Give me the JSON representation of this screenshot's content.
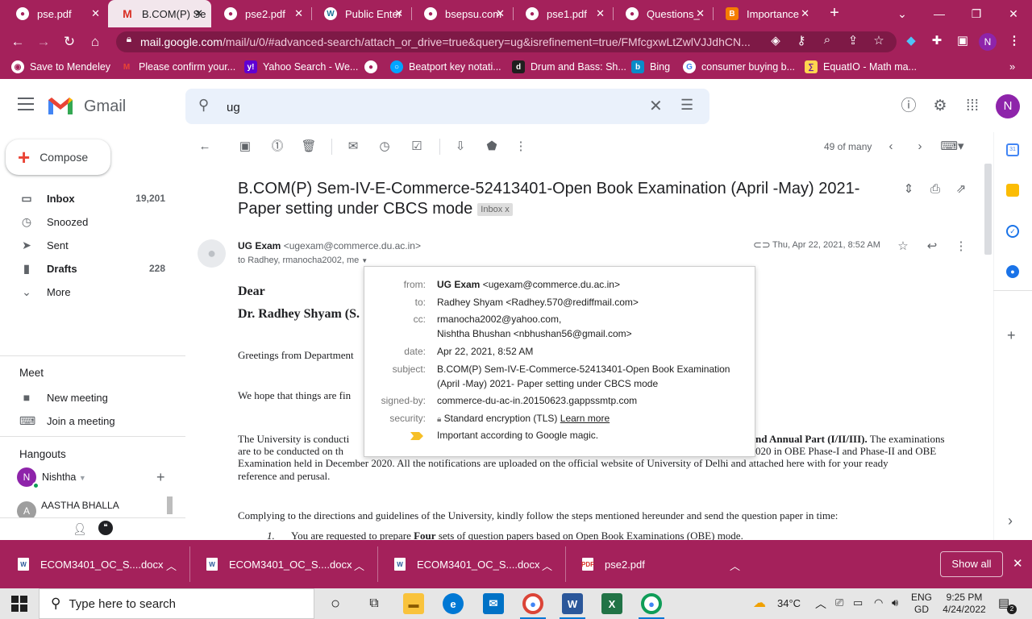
{
  "browser": {
    "tabs": [
      {
        "title": "pse.pdf",
        "active": false
      },
      {
        "title": "B.COM(P) Se",
        "active": true
      },
      {
        "title": "pse2.pdf",
        "active": false
      },
      {
        "title": "Public Enter",
        "active": false
      },
      {
        "title": "bsepsu.com",
        "active": false
      },
      {
        "title": "pse1.pdf",
        "active": false
      },
      {
        "title": "Questions_",
        "active": false
      },
      {
        "title": "Importance",
        "active": false
      }
    ],
    "url_host": "mail.google.com",
    "url_path": "/mail/u/0/#advanced-search/attach_or_drive=true&query=ug&isrefinement=true/FMfcgxwLtZwlVJJdhCN...",
    "profile_initial": "N",
    "bookmarks": [
      "Save to Mendeley",
      "Please confirm your...",
      "Yahoo Search - We...",
      "",
      "Beatport key notati...",
      "Drum and Bass: Sh...",
      "Bing",
      "consumer buying b...",
      "EquatIO - Math ma..."
    ]
  },
  "gmail": {
    "product_name": "Gmail",
    "search_value": "ug",
    "avatar_initial": "N",
    "compose_label": "Compose",
    "nav": [
      {
        "label": "Inbox",
        "count": "19,201",
        "icon": "inbox-icon",
        "bold": true
      },
      {
        "label": "Snoozed",
        "count": "",
        "icon": "clock-icon",
        "bold": false
      },
      {
        "label": "Sent",
        "count": "",
        "icon": "send-icon",
        "bold": false
      },
      {
        "label": "Drafts",
        "count": "228",
        "icon": "draft-icon",
        "bold": true
      },
      {
        "label": "More",
        "count": "",
        "icon": "chevron-down-icon",
        "bold": false
      }
    ],
    "meet": {
      "title": "Meet",
      "new_meeting": "New meeting",
      "join_meeting": "Join a meeting"
    },
    "hangouts": {
      "title": "Hangouts",
      "user_initial": "N",
      "user": "Nishtha",
      "contact_initial": "A",
      "contact": "AASTHA BHALLA"
    },
    "pager": "49 of many"
  },
  "message": {
    "subject": "B.COM(P) Sem-IV-E-Commerce-52413401-Open Book Examination (April -May) 2021- Paper setting under CBCS mode",
    "label_chip": "Inbox",
    "chip_close": "x",
    "sender_name": "UG Exam",
    "sender_email": "<ugexam@commerce.du.ac.in>",
    "to_line": "to Radhey, rmanocha2002, me",
    "date": "Thu, Apr 22, 2021, 8:52 AM",
    "body": {
      "dear": "Dear",
      "salutation": "Dr. Radhey Shyam (S.",
      "greetings": "Greetings from Department",
      "hope": "We hope that things are fin",
      "para1_start": "The University is conducti",
      "para1_bold": "nd Annual Part (I/II/III).",
      "para1_end": " The examinations",
      "para1_line2a": "are to be conducted on th",
      "para1_line2b": "020 in OBE Phase-I and Phase-II and OBE",
      "para1_line3": "Examination held in December 2020. All the notifications are uploaded on the official website of University of Delhi and attached here with for your ready",
      "para1_line4": "reference and perusal.",
      "para2": "Complying to the directions and guidelines of the University, kindly follow the steps mentioned hereunder and send the question paper in time:",
      "item1_num": "1.",
      "item1_a": "You are requested to prepare ",
      "item1_bold": "Four",
      "item1_b": " sets of question papers based on Open Book Examinations (OBE) mode."
    }
  },
  "details_popup": {
    "from_label": "from:",
    "from_name": "UG Exam",
    "from_email": "<ugexam@commerce.du.ac.in>",
    "to_label": "to:",
    "to_value": "Radhey Shyam <Radhey.570@rediffmail.com>",
    "cc_label": "cc:",
    "cc_1": "rmanocha2002@yahoo.com,",
    "cc_2": "Nishtha Bhushan <nbhushan56@gmail.com>",
    "date_label": "date:",
    "date_value": "Apr 22, 2021, 8:52 AM",
    "subject_label": "subject:",
    "subject_1": "B.COM(P) Sem-IV-E-Commerce-52413401-Open Book Examination",
    "subject_2": "(April -May) 2021- Paper setting under CBCS mode",
    "signed_label": "signed-by:",
    "signed_value": "commerce-du-ac-in.20150623.gappssmtp.com",
    "security_label": "security:",
    "security_value": "Standard encryption (TLS)",
    "learn_more": "Learn more",
    "importance_value": "Important according to Google magic."
  },
  "downloads": [
    "ECOM3401_OC_S....docx",
    "ECOM3401_OC_S....docx",
    "ECOM3401_OC_S....docx",
    "pse2.pdf"
  ],
  "downloads_show_all": "Show all",
  "taskbar": {
    "search_placeholder": "Type here to search",
    "temperature": "34°C",
    "lang_1": "ENG",
    "lang_2": "GD",
    "time": "9:25 PM",
    "date": "4/24/2022",
    "notif_count": "2"
  },
  "colors": {
    "chrome_theme": "#a4215b",
    "gmail_red": "#ea4335",
    "avatar": "#8e24aa"
  }
}
